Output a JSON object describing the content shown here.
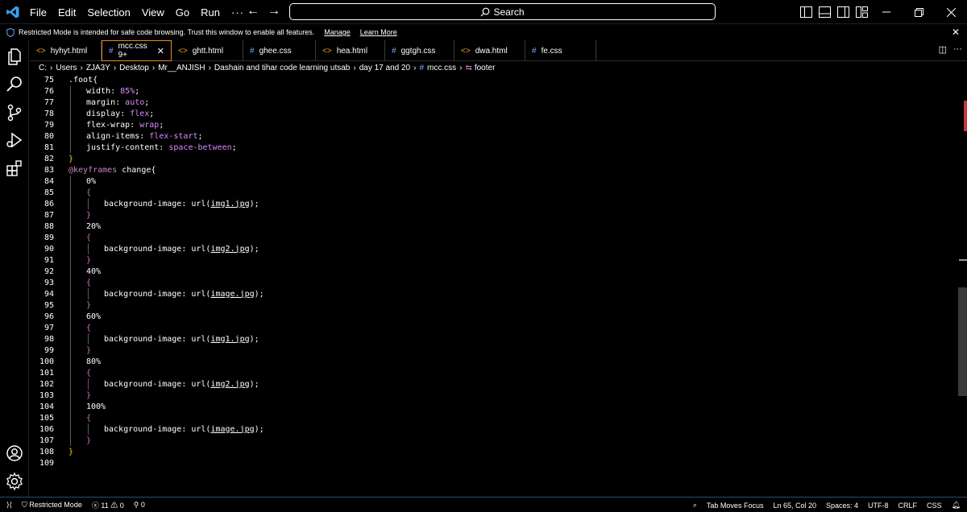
{
  "menu": [
    "File",
    "Edit",
    "Selection",
    "View",
    "Go",
    "Run",
    "···"
  ],
  "search": {
    "label": "Search"
  },
  "banner": {
    "text": "Restricted Mode is intended for safe code browsing. Trust this window to enable all features.",
    "manage": "Manage",
    "learn_more": "Learn More"
  },
  "tabs": [
    {
      "label": "hyhyt.html",
      "type": "html"
    },
    {
      "label": "mcc.css 9+",
      "type": "css",
      "active": true
    },
    {
      "label": "ghtt.html",
      "type": "html"
    },
    {
      "label": "ghee.css",
      "type": "css"
    },
    {
      "label": "hea.html",
      "type": "html"
    },
    {
      "label": "ggtgh.css",
      "type": "css"
    },
    {
      "label": "dwa.html",
      "type": "html"
    },
    {
      "label": "fe.css",
      "type": "css"
    }
  ],
  "breadcrumb": [
    "C:",
    "Users",
    "ZJA3Y",
    "Desktop",
    "Mr__ANJISH",
    "Dashain and tihar code learning utsab",
    "day 17 and 20",
    "mcc.css",
    "footer"
  ],
  "line_numbers": [
    "75",
    "76",
    "77",
    "78",
    "79",
    "80",
    "81",
    "82",
    "83",
    "84",
    "85",
    "86",
    "87",
    "88",
    "89",
    "90",
    "91",
    "92",
    "93",
    "94",
    "95",
    "96",
    "97",
    "98",
    "99",
    "100",
    "101",
    "102",
    "103",
    "104",
    "105",
    "106",
    "107",
    "108",
    "109"
  ],
  "code": {
    "l75_sel": ".foot{",
    "l76_p": "width: ",
    "l76_v": "85%",
    "l77_p": "margin: ",
    "l77_v": "auto",
    "l78_p": "display: ",
    "l78_v": "flex",
    "l79_p": "flex-wrap: ",
    "l79_v": "wrap",
    "l80_p": "align-items: ",
    "l80_v": "flex-start",
    "l81_p": "justify-content: ",
    "l81_v": "space-between",
    "close": "}",
    "open": "{",
    "l83_kw": "@keyframes",
    "l83_name": " change{",
    "pct": [
      "0%",
      "20%",
      "40%",
      "60%",
      "80%",
      "100%"
    ],
    "bg_prop": "background-image: url(",
    "urls": [
      "img1.jpg",
      "img2.jpg",
      "image.jpg",
      "img1.jpg",
      "img2.jpg",
      "image.jpg"
    ],
    "bg_end": ");"
  },
  "status": {
    "remote": "⟩⟨",
    "mode": "Restricted Mode",
    "errors": "11",
    "warnings": "0",
    "ports": "0",
    "tab_moves": "Tab Moves Focus",
    "position": "Ln 65, Col 20",
    "spaces": "Spaces: 4",
    "encoding": "UTF-8",
    "eol": "CRLF",
    "language": "CSS"
  },
  "colors": {
    "accent_tab_border": "#e58a17",
    "css_keyword": "#c586c0",
    "css_value": "#d98bff",
    "brace_gold": "#ffd700"
  }
}
